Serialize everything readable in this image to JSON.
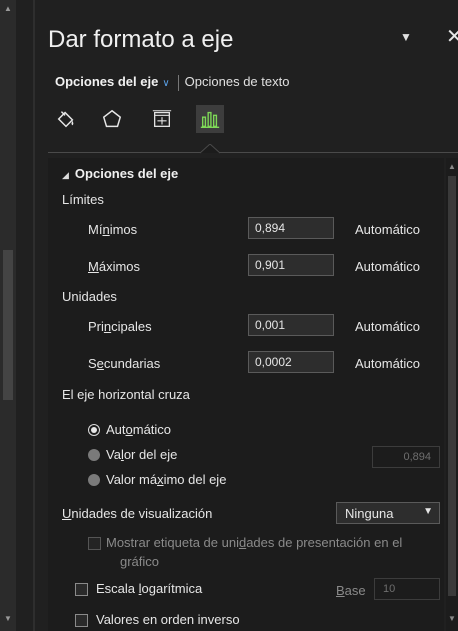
{
  "pane": {
    "title": "Dar formato a eje",
    "menu_icon": "chevron-down-icon",
    "close_icon": "close-icon"
  },
  "tabs": {
    "axis_options": "Opciones del eje",
    "text_options": "Opciones de texto"
  },
  "icon_tabs": [
    "fill-line-icon",
    "effects-icon",
    "size-properties-icon",
    "axis-options-chart-icon"
  ],
  "section": {
    "title": "Opciones del eje",
    "limits_label": "Límites",
    "min": {
      "label_pre": "Mí",
      "label_u": "n",
      "label_post": "imos",
      "value": "0,894",
      "auto": "Automático"
    },
    "max": {
      "label_pre": "",
      "label_u": "M",
      "label_post": "áximos",
      "value": "0,901",
      "auto": "Automático"
    },
    "units_label": "Unidades",
    "major": {
      "label_pre": "Pri",
      "label_u": "n",
      "label_post": "cipales",
      "value": "0,001",
      "auto": "Automático"
    },
    "minor": {
      "label_pre": "S",
      "label_u": "e",
      "label_post": "cundarias",
      "value": "0,0002",
      "auto": "Automático"
    },
    "crosses_label": "El eje horizontal cruza",
    "radio_auto": {
      "pre": "Aut",
      "u": "o",
      "post": "mático"
    },
    "radio_value": {
      "pre": "Va",
      "u": "l",
      "post": "or del eje",
      "value": "0,894"
    },
    "radio_max": {
      "pre": "Valor má",
      "u": "x",
      "post": "imo del eje"
    },
    "display_units": {
      "u": "U",
      "post": "nidades de visualización",
      "value": "Ninguna"
    },
    "show_label": {
      "line1_pre": "Mostrar etiqueta de uni",
      "line1_u": "d",
      "line1_post": "ades de presentación en el",
      "line2": "gráfico"
    },
    "log_scale": {
      "pre": "Escala ",
      "u": "l",
      "post": "ogarítmica",
      "base_u": "B",
      "base_post": "ase",
      "base_value": "10"
    },
    "reverse": "Valores en orden inverso"
  },
  "colors": {
    "accent": "#5aa0e6",
    "background": "#202020",
    "field_bg": "#2d2d2d"
  }
}
